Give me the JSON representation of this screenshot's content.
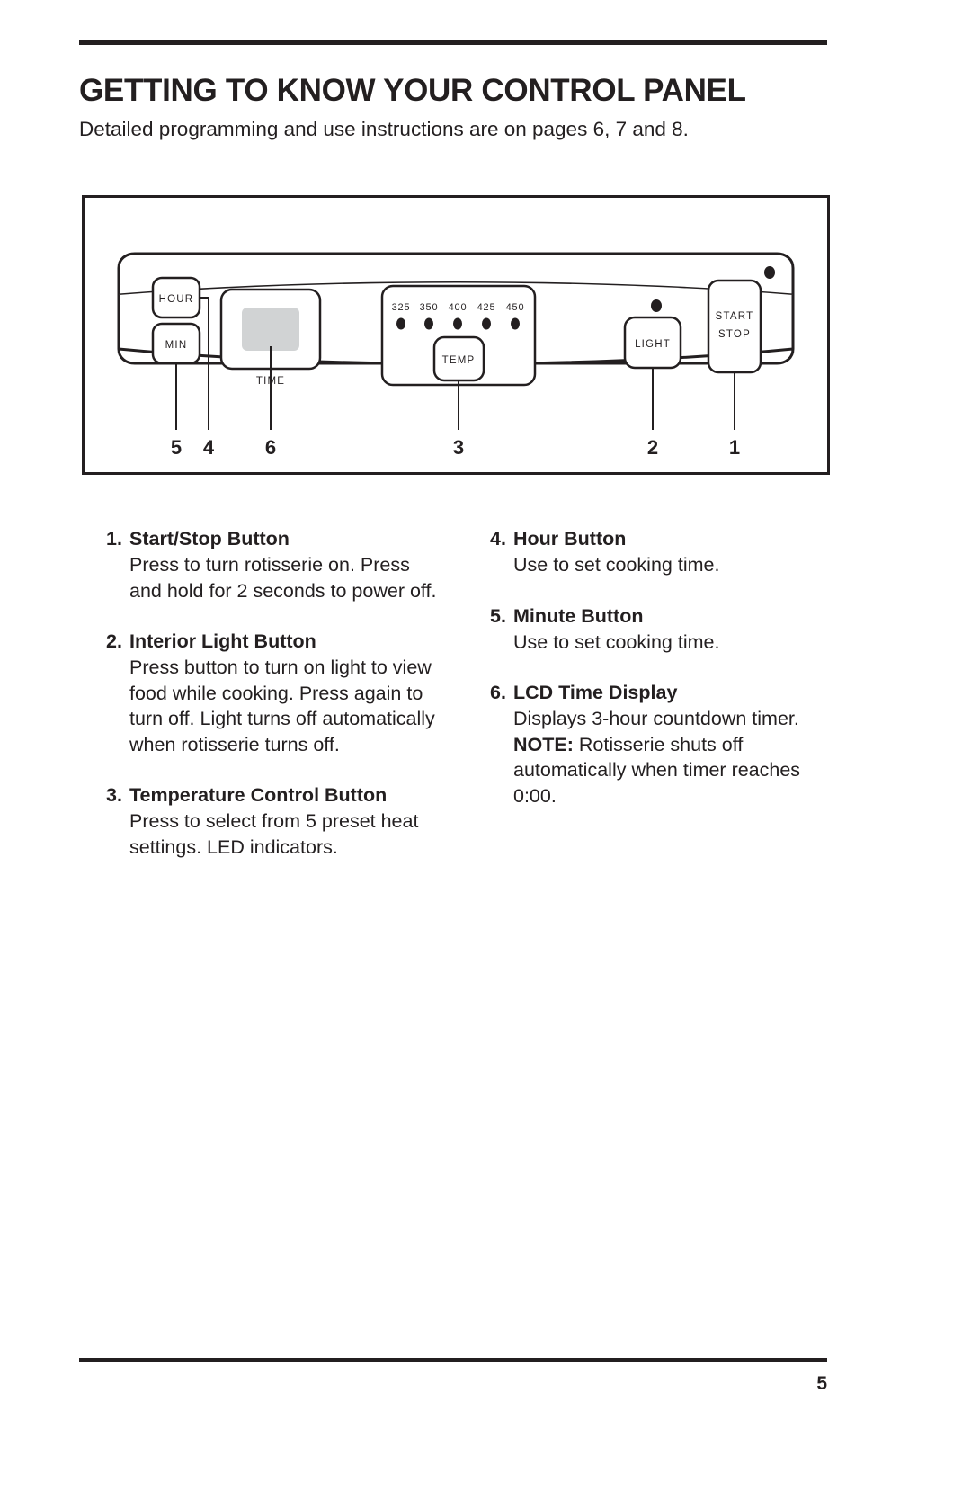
{
  "header": {
    "title": "GETTING TO KNOW YOUR CONTROL PANEL",
    "subtitle": "Detailed programming and use instructions are on pages 6, 7 and 8."
  },
  "diagram": {
    "name": "control-panel-diagram",
    "buttons": {
      "hour": "HOUR",
      "min": "MIN",
      "time": "TIME",
      "temp": "TEMP",
      "light": "LIGHT",
      "start": "START",
      "stop": "STOP"
    },
    "temperature_presets": [
      "325",
      "350",
      "400",
      "425",
      "450"
    ],
    "callouts": [
      "5",
      "4",
      "6",
      "3",
      "2",
      "1"
    ],
    "colors": {
      "outline": "#231f20",
      "lcd_fill": "#d1d3d4",
      "led_fill": "#231f20"
    }
  },
  "instructions": {
    "left": [
      {
        "num": "1.",
        "title": "Start/Stop Button",
        "body": "Press to turn rotisserie on. Press and hold for 2 seconds to power off."
      },
      {
        "num": "2.",
        "title": "Interior Light Button",
        "body": "Press button to turn on light to view food while cooking. Press again to turn off. Light turns off automatically when rotisserie turns off."
      },
      {
        "num": "3.",
        "title": "Temperature Control Button",
        "body": "Press to select from 5 preset heat settings. LED indicators."
      }
    ],
    "right": [
      {
        "num": "4.",
        "title": "Hour Button",
        "body": "Use to set cooking time."
      },
      {
        "num": "5.",
        "title": "Minute Button",
        "body": "Use to set cooking time."
      },
      {
        "num": "6.",
        "title": "LCD Time Display",
        "body_1": "Displays 3-hour countdown timer.",
        "note_label": "NOTE:",
        "body_2": " Rotisserie shuts off automatically when timer reaches 0:00."
      }
    ]
  },
  "footer": {
    "page_number": "5"
  }
}
